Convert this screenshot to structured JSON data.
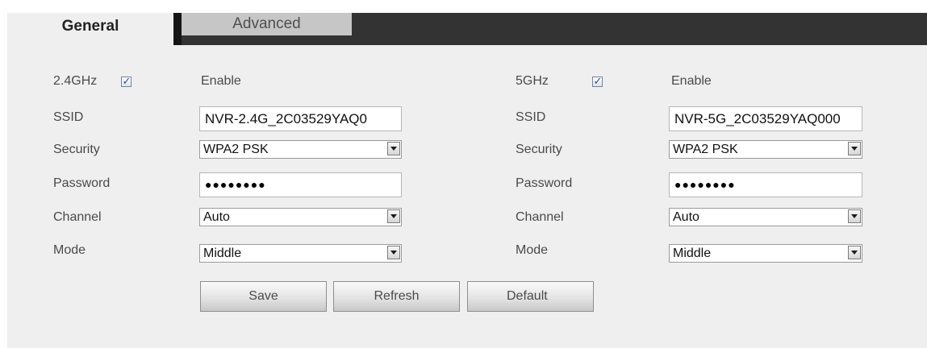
{
  "tabs": {
    "general": "General",
    "advanced": "Advanced"
  },
  "band24": {
    "title": "2.4GHz",
    "enabled": true,
    "enable_label": "Enable",
    "ssid_label": "SSID",
    "ssid_value": "NVR-2.4G_2C03529YAQ0",
    "security_label": "Security",
    "security_value": "WPA2 PSK",
    "password_label": "Password",
    "password_value": "●●●●●●●●",
    "channel_label": "Channel",
    "channel_value": "Auto",
    "mode_label": "Mode",
    "mode_value": "Middle"
  },
  "band5": {
    "title": "5GHz",
    "enabled": true,
    "enable_label": "Enable",
    "ssid_label": "SSID",
    "ssid_value": "NVR-5G_2C03529YAQ000",
    "security_label": "Security",
    "security_value": "WPA2 PSK",
    "password_label": "Password",
    "password_value": "●●●●●●●●",
    "channel_label": "Channel",
    "channel_value": "Auto",
    "mode_label": "Mode",
    "mode_value": "Middle"
  },
  "buttons": {
    "save": "Save",
    "refresh": "Refresh",
    "default": "Default"
  },
  "colors": {
    "tabbar": "#333333",
    "panel": "#efefef",
    "checkmark": "#2b4ca0"
  }
}
